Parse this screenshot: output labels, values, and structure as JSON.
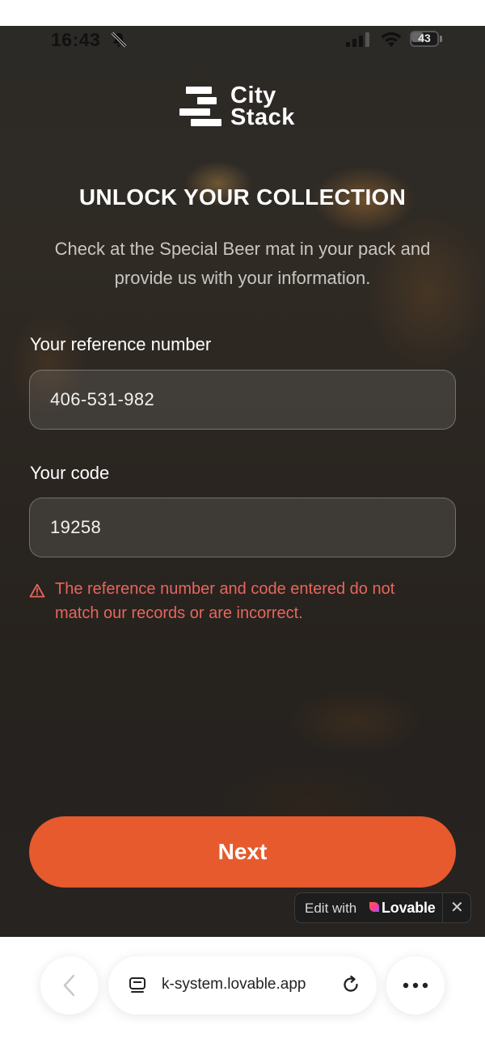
{
  "status_bar": {
    "time": "16:43",
    "battery_level": "43",
    "icons": [
      "bell-slash-icon",
      "signal-icon",
      "wifi-icon",
      "battery-icon"
    ]
  },
  "logo": {
    "line1": "City",
    "line2": "Stack"
  },
  "header": {
    "title": "UNLOCK YOUR COLLECTION",
    "subtitle": "Check at the Special Beer mat in your pack and provide us with your information."
  },
  "form": {
    "reference_label": "Your reference number",
    "reference_value": "406-531-982",
    "code_label": "Your code",
    "code_value": "19258",
    "error_message": "The reference number and code entered do not match our records or are incorrect."
  },
  "actions": {
    "next_label": "Next"
  },
  "lovable_badge": {
    "prefix": "Edit with",
    "brand": "Lovable",
    "close": "✕"
  },
  "browser": {
    "url": "k-system.lovable.app"
  },
  "colors": {
    "accent": "#e65a2e",
    "error": "#e7665c",
    "background": "#2a2520"
  }
}
